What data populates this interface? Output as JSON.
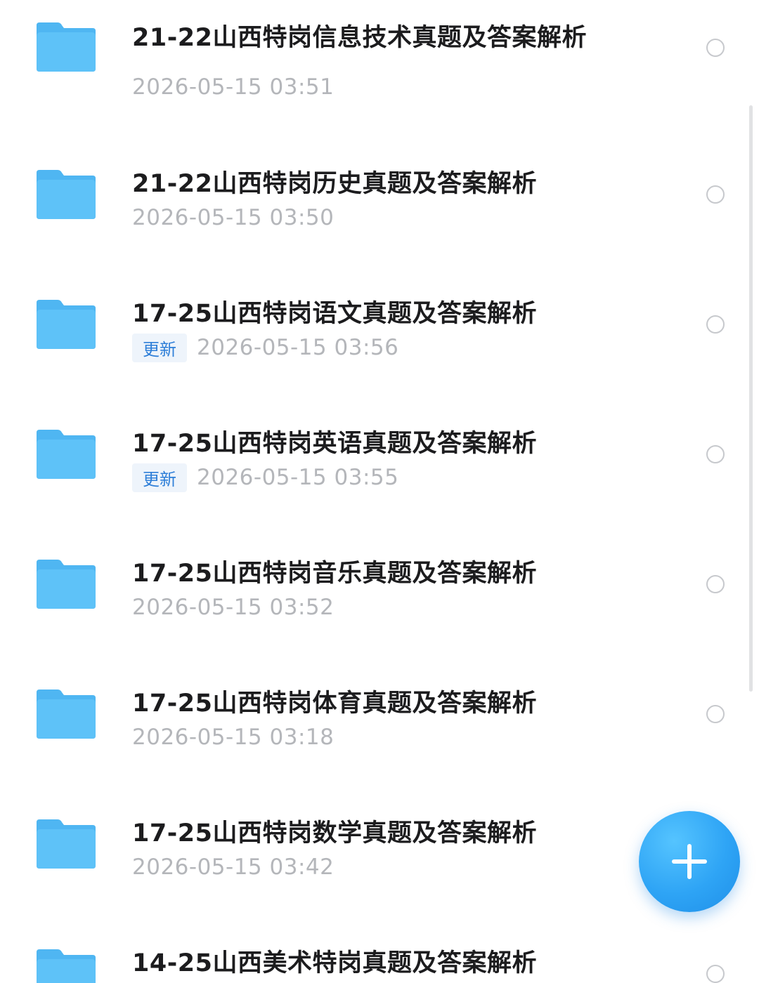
{
  "colors": {
    "folder": "#5ec2f8",
    "folder_tab": "#4fb6f2",
    "accent": "#2ea4f5",
    "update_badge_text": "#2f7fd8",
    "timestamp": "#b4b6ba"
  },
  "files": [
    {
      "name": "21-22山西特岗信息技术真题及答案解析",
      "date": "2026-05-15 03:51",
      "badge": null,
      "icon": "folder-icon"
    },
    {
      "name": "21-22山西特岗历史真题及答案解析",
      "date": "2026-05-15 03:50",
      "badge": null,
      "icon": "folder-icon"
    },
    {
      "name": "17-25山西特岗语文真题及答案解析",
      "date": "2026-05-15 03:56",
      "badge": "更新",
      "icon": "folder-icon"
    },
    {
      "name": "17-25山西特岗英语真题及答案解析",
      "date": "2026-05-15 03:55",
      "badge": "更新",
      "icon": "folder-icon"
    },
    {
      "name": "17-25山西特岗音乐真题及答案解析",
      "date": "2026-05-15 03:52",
      "badge": null,
      "icon": "folder-icon"
    },
    {
      "name": "17-25山西特岗体育真题及答案解析",
      "date": "2026-05-15 03:18",
      "badge": null,
      "icon": "folder-icon"
    },
    {
      "name": "17-25山西特岗数学真题及答案解析",
      "date": "2026-05-15 03:42",
      "badge": null,
      "icon": "folder-icon"
    },
    {
      "name": "14-25山西美术特岗真题及答案解析",
      "date": "",
      "badge": null,
      "icon": "folder-icon"
    }
  ],
  "fab": {
    "icon": "plus-icon"
  }
}
